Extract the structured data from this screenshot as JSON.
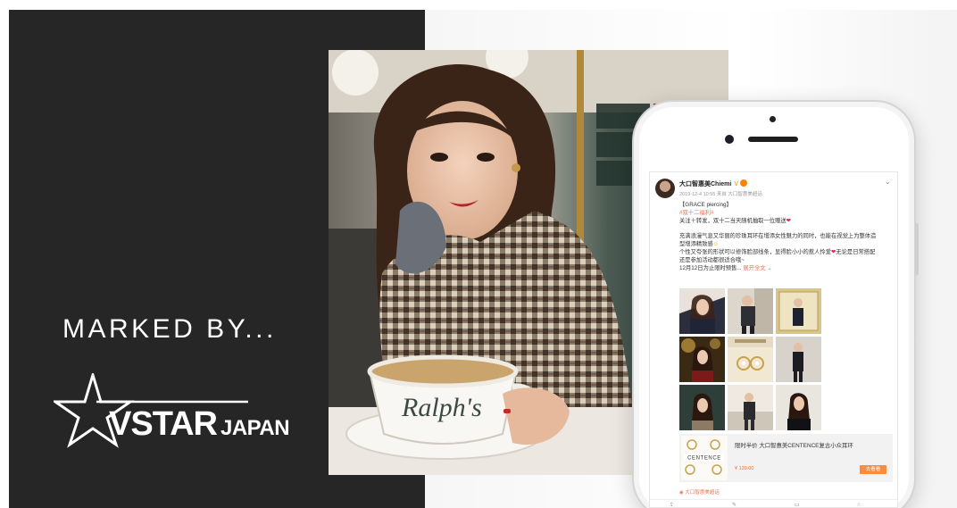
{
  "brand": {
    "tagline": "MARKED BY...",
    "logo_vstar": "VSTAR",
    "logo_japan": "JAPAN"
  },
  "photo": {
    "cup_text": "Ralph's"
  },
  "post": {
    "username": "大口智惠美Chiemi",
    "verified": "V",
    "meta": "2019-12-4 10:55 来自 大口智惠美超话",
    "title": "【GRACE piercing】",
    "hashtag": "#双十二福利#",
    "line_follow": "关注＋转发，双十二当天随机抽取一位赠送",
    "para1_l1": "充满浪漫气息又华丽的珍珠耳环在增添女性魅力的同时，也能在视觉上为整体造",
    "para1_l2": "型增添精致感",
    "para2_l1": "个性又夸张的形状可以修饰脸部线条，显得脸小小的惹人怜爱",
    "para2_l1b": "无论是日常搭配",
    "para2_l2": "还是参加活动都很适合哦~",
    "line_date": "12月12日为止限时预售...",
    "expand": "展开全文",
    "card_title": "限时半价 大口智惠美CENTENCE复古小众耳环",
    "card_brand": "CENTENCE",
    "card_price": "¥ 139.00",
    "card_button": "去看看",
    "source": "大口智惠美超话"
  },
  "colors": {
    "dark_panel": "#262626",
    "link": "#eb7350",
    "button": "#ff8a3c"
  }
}
